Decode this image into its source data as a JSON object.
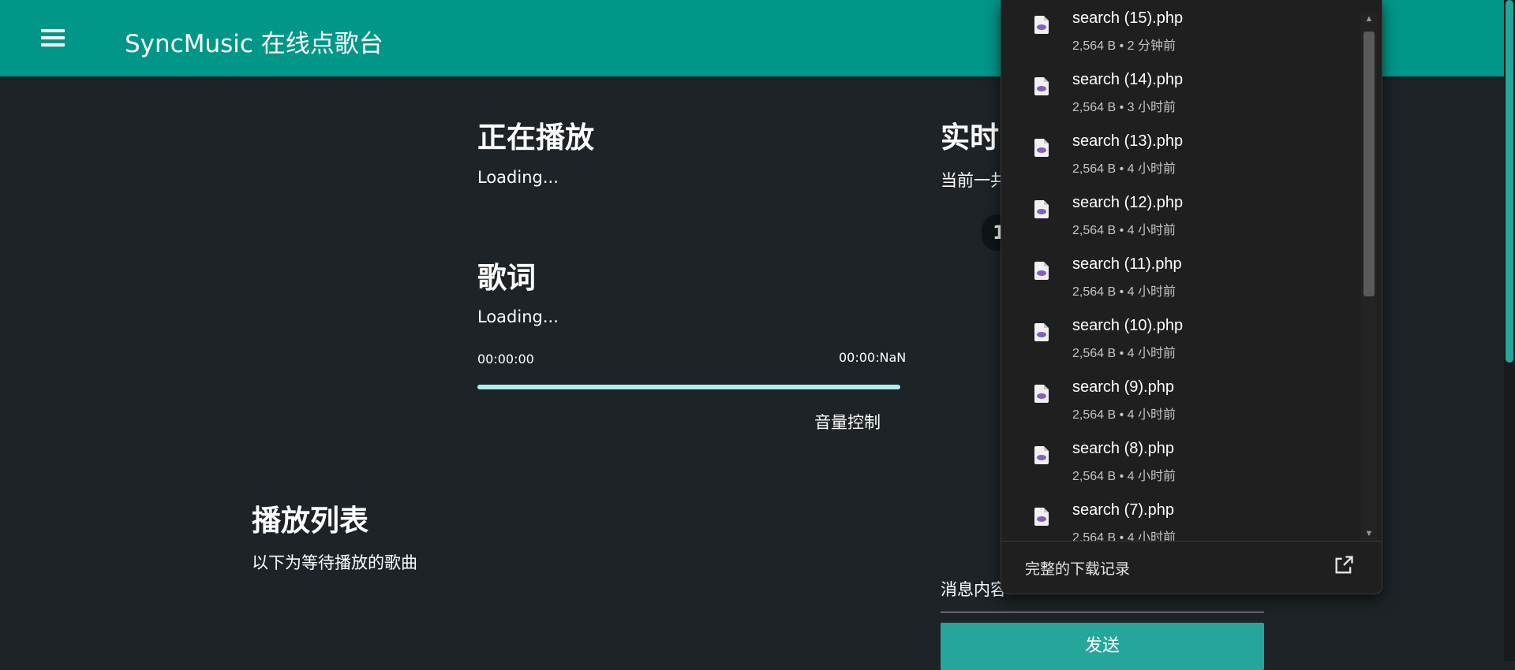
{
  "appbar": {
    "title": "SyncMusic 在线点歌台",
    "menu_icon": "menu-icon"
  },
  "now_playing": {
    "heading": "正在播放",
    "status": "Loading...",
    "lyrics_heading": "歌词",
    "lyrics_status": "Loading...",
    "time_current": "00:00:00",
    "time_total": "00:00:NaN",
    "progress": 0,
    "volume_label": "音量控制"
  },
  "playlist": {
    "heading": "播放列表",
    "subtitle": "以下为等待播放的歌曲"
  },
  "realtime": {
    "heading_partial": "实时",
    "status_partial": "当前一共",
    "chip_partial": "1",
    "message_label_partial": "消息内容",
    "send_label": "发送"
  },
  "downloads": {
    "items": [
      {
        "name": "search (15).php",
        "meta": "2,564 B • 2 分钟前"
      },
      {
        "name": "search (14).php",
        "meta": "2,564 B • 3 小时前"
      },
      {
        "name": "search (13).php",
        "meta": "2,564 B • 4 小时前"
      },
      {
        "name": "search (12).php",
        "meta": "2,564 B • 4 小时前"
      },
      {
        "name": "search (11).php",
        "meta": "2,564 B • 4 小时前"
      },
      {
        "name": "search (10).php",
        "meta": "2,564 B • 4 小时前"
      },
      {
        "name": "search (9).php",
        "meta": "2,564 B • 4 小时前"
      },
      {
        "name": "search (8).php",
        "meta": "2,564 B • 4 小时前"
      },
      {
        "name": "search (7).php",
        "meta": "2,564 B • 4 小时前"
      }
    ],
    "file_icon": "php-file-icon",
    "footer_label": "完整的下载记录",
    "footer_icon": "open-external-icon"
  },
  "colors": {
    "appbar": "#009688",
    "background": "#1d2326",
    "progress_track": "#b2ebf2",
    "send_button": "#26a69a",
    "panel": "#1f1f1f"
  }
}
